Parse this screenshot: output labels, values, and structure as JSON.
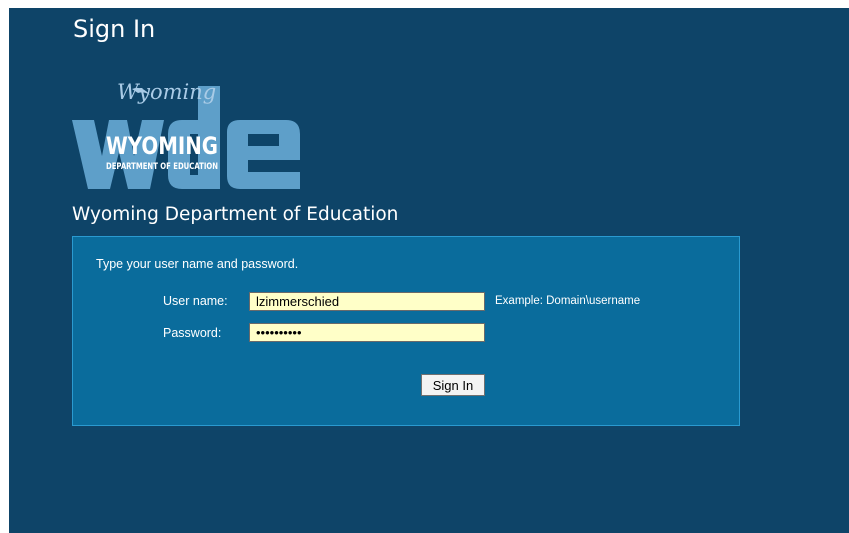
{
  "header": {
    "title": "Sign In"
  },
  "logo": {
    "script_text": "Wyoming",
    "state_text": "WYOMING",
    "dept_text": "DEPARTMENT OF EDUCATION",
    "monogram": "wde"
  },
  "organization": {
    "name": "Wyoming Department of Education"
  },
  "form": {
    "instructions": "Type your user name and password.",
    "username_label": "User name:",
    "username_value": "lzimmerschied",
    "username_example": "Example: Domain\\username",
    "password_label": "Password:",
    "password_value": "**********",
    "submit_label": "Sign In"
  },
  "colors": {
    "background": "#0e4468",
    "panel": "#0a6c9c",
    "input_fill": "#ffffc8"
  }
}
